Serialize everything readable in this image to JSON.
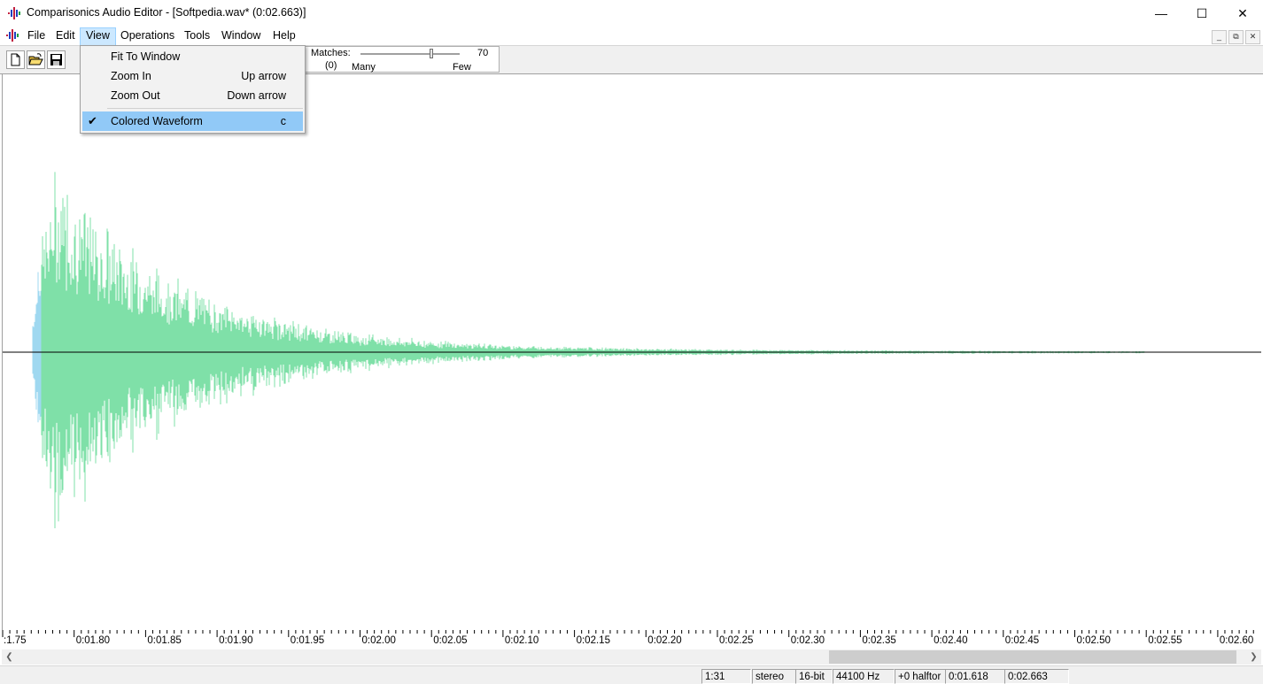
{
  "window": {
    "title": "Comparisonics Audio Editor - [Softpedia.wav* (0:02.663)]",
    "minimize": "—",
    "maximize": "☐",
    "close": "✕"
  },
  "menu": {
    "items": [
      "File",
      "Edit",
      "View",
      "Operations",
      "Tools",
      "Window",
      "Help"
    ],
    "active": "View"
  },
  "mdi_controls": {
    "minimize": "_",
    "restore": "⧉",
    "close": "✕"
  },
  "toolbar": {
    "buttons": [
      "new-file-icon",
      "open-folder-icon",
      "save-disk-icon"
    ],
    "matches": {
      "label": "Matches:",
      "value": "70",
      "count": "(0)",
      "left": "Many",
      "right": "Few",
      "slider_fraction": 0.7
    }
  },
  "view_menu": {
    "items": [
      {
        "label": "Fit To Window",
        "shortcut": ""
      },
      {
        "label": "Zoom In",
        "shortcut": "Up arrow"
      },
      {
        "label": "Zoom Out",
        "shortcut": "Down arrow"
      },
      {
        "label": "Colored Waveform",
        "shortcut": "c",
        "checked": true
      }
    ],
    "check_glyph": "✔"
  },
  "ruler": {
    "labels": [
      ":1.75",
      "0:01.80",
      "0:01.85",
      "0:01.90",
      "0:01.95",
      "0:02.00",
      "0:02.05",
      "0:02.10",
      "0:02.15",
      "0:02.20",
      "0:02.25",
      "0:02.30",
      "0:02.35",
      "0:02.40",
      "0:02.45",
      "0:02.50",
      "0:02.55",
      "0:02.60"
    ]
  },
  "scrollbar": {
    "left_arrow": "❮",
    "right_arrow": "❯"
  },
  "status": {
    "zoom": "1:31",
    "channels": "stereo",
    "bits": "16-bit",
    "rate": "44100 Hz",
    "pitch": "+0 halftor",
    "position": "0:01.618",
    "length": "0:02.663"
  },
  "colors": {
    "waveform": "#7fe0a8",
    "waveform_onset": "#9fd8f0",
    "selection": "#91c9f7"
  }
}
